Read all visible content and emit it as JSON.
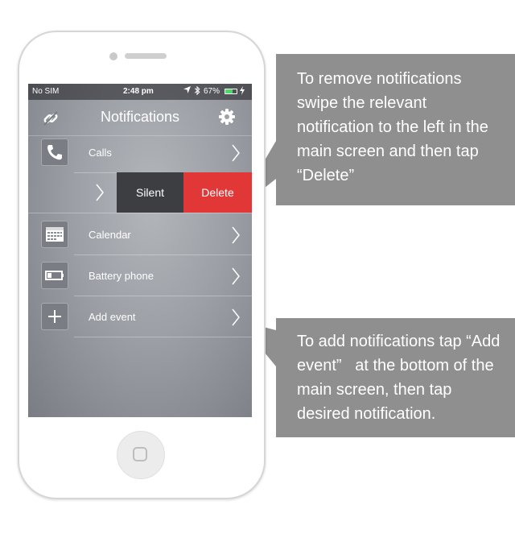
{
  "status_bar": {
    "carrier": "No SIM",
    "time": "2:48 pm",
    "battery": "67%",
    "battery_level": 0.67,
    "icons": [
      "location-arrow-icon",
      "bluetooth-icon",
      "battery-icon",
      "charging-icon"
    ]
  },
  "nav": {
    "title": "Notifications",
    "left_icon": "link-broken-icon",
    "right_icon": "gear-icon"
  },
  "rows": [
    {
      "label": "Calls",
      "icon": "phone-icon"
    },
    {
      "label": "Calendar",
      "icon": "calendar-icon"
    },
    {
      "label": "Battery phone",
      "icon": "battery-icon"
    },
    {
      "label": "Add event",
      "icon": "plus-icon"
    }
  ],
  "swipe_actions": {
    "silent": "Silent",
    "delete": "Delete"
  },
  "callouts": {
    "remove_lines": [
      "To remove notifications",
      "swipe the relevant",
      "notification to the left in the",
      "main screen and then tap",
      "“Delete”"
    ],
    "add_lines": [
      "To add notifications tap “Add",
      "event”   at the bottom of the",
      "main screen, then tap",
      "desired notification."
    ]
  },
  "colors": {
    "delete": "#e23737",
    "silent": "#3d3e41",
    "callout": "#8f8f8f",
    "battery_fill": "#4cd964"
  }
}
